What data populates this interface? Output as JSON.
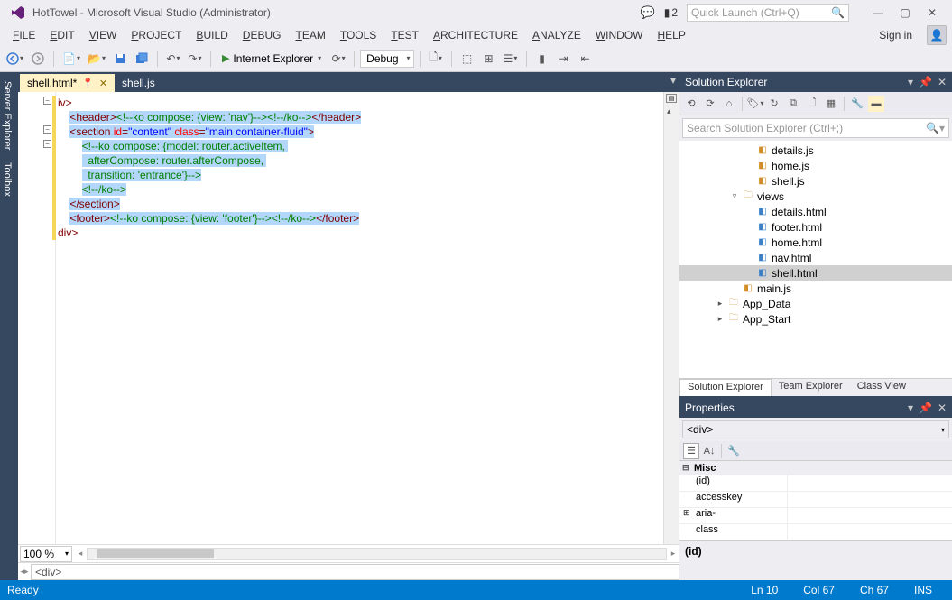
{
  "title": "HotTowel - Microsoft Visual Studio (Administrator)",
  "quick_launch_placeholder": "Quick Launch (Ctrl+Q)",
  "filter_count": "2",
  "menu": [
    "FILE",
    "EDIT",
    "VIEW",
    "PROJECT",
    "BUILD",
    "DEBUG",
    "TEAM",
    "TOOLS",
    "TEST",
    "ARCHITECTURE",
    "ANALYZE",
    "WINDOW",
    "HELP"
  ],
  "signin": "Sign in",
  "start_target": "Internet Explorer",
  "config": "Debug",
  "side_tabs": [
    "Server Explorer",
    "Toolbox"
  ],
  "doc_tabs": [
    {
      "label": "shell.html*",
      "active": true
    },
    {
      "label": "shell.js",
      "active": false
    }
  ],
  "code_lines": [
    {
      "indent": 0,
      "segs": [
        {
          "c": "t-tag",
          "t": "iv"
        },
        {
          "c": "t-tag",
          "t": ">"
        }
      ],
      "sel": false
    },
    {
      "indent": 1,
      "segs": [
        {
          "c": "t-tag",
          "t": "<header>"
        },
        {
          "c": "t-cm",
          "t": "<!--ko compose: {view: 'nav'}-->"
        },
        {
          "c": "t-cm",
          "t": "<!--/ko-->"
        },
        {
          "c": "t-tag",
          "t": "</header>"
        }
      ],
      "sel": true
    },
    {
      "indent": 1,
      "segs": [
        {
          "c": "t-tag",
          "t": "<section "
        },
        {
          "c": "t-attr",
          "t": "id"
        },
        {
          "c": "t-tag",
          "t": "="
        },
        {
          "c": "t-str",
          "t": "\"content\""
        },
        {
          "c": "t-tag",
          "t": " "
        },
        {
          "c": "t-attr",
          "t": "class"
        },
        {
          "c": "t-tag",
          "t": "="
        },
        {
          "c": "t-str",
          "t": "\"main container-fluid\""
        },
        {
          "c": "t-tag",
          "t": ">"
        }
      ],
      "sel": true
    },
    {
      "indent": 2,
      "segs": [
        {
          "c": "t-cm",
          "t": "<!--ko compose: {model: router.activeItem, "
        }
      ],
      "sel": true
    },
    {
      "indent": 2,
      "segs": [
        {
          "c": "t-cm",
          "t": "  afterCompose: router.afterCompose, "
        }
      ],
      "sel": true
    },
    {
      "indent": 2,
      "segs": [
        {
          "c": "t-cm",
          "t": "  transition: 'entrance'}-->"
        }
      ],
      "sel": true
    },
    {
      "indent": 2,
      "segs": [
        {
          "c": "t-cm",
          "t": "<!--/ko-->"
        }
      ],
      "sel": true
    },
    {
      "indent": 1,
      "segs": [
        {
          "c": "t-tag",
          "t": "</section>"
        }
      ],
      "sel": true
    },
    {
      "indent": 1,
      "segs": [
        {
          "c": "t-tag",
          "t": "<footer>"
        },
        {
          "c": "t-cm",
          "t": "<!--ko compose: {view: 'footer'}-->"
        },
        {
          "c": "t-cm",
          "t": "<!--/ko-->"
        },
        {
          "c": "t-tag",
          "t": "</footer>"
        }
      ],
      "sel": true
    },
    {
      "indent": 0,
      "segs": [
        {
          "c": "t-tag",
          "t": "div"
        },
        {
          "c": "t-tag",
          "t": ">"
        }
      ],
      "sel": false
    }
  ],
  "zoom": "100 %",
  "nav_crumb": "<div>",
  "solution_explorer": {
    "title": "Solution Explorer",
    "search_placeholder": "Search Solution Explorer (Ctrl+;)",
    "items": [
      {
        "level": "l1",
        "icon": "js",
        "label": "details.js"
      },
      {
        "level": "l1",
        "icon": "js",
        "label": "home.js"
      },
      {
        "level": "l1",
        "icon": "js",
        "label": "shell.js"
      },
      {
        "level": "l2",
        "icon": "folder",
        "label": "views",
        "expanded": true,
        "twisty": "▿"
      },
      {
        "level": "l1",
        "icon": "html",
        "label": "details.html"
      },
      {
        "level": "l1",
        "icon": "html",
        "label": "footer.html"
      },
      {
        "level": "l1",
        "icon": "html",
        "label": "home.html"
      },
      {
        "level": "l1",
        "icon": "html",
        "label": "nav.html"
      },
      {
        "level": "l1",
        "icon": "html",
        "label": "shell.html",
        "selected": true
      },
      {
        "level": "l2",
        "icon": "js",
        "label": "main.js"
      },
      {
        "level": "l3",
        "icon": "folder",
        "label": "App_Data",
        "twisty": "▸"
      },
      {
        "level": "l3",
        "icon": "folder",
        "label": "App_Start",
        "twisty": "▸"
      }
    ],
    "tabs": [
      "Solution Explorer",
      "Team Explorer",
      "Class View"
    ]
  },
  "properties": {
    "title": "Properties",
    "element": "<div>",
    "category": "Misc",
    "rows": [
      {
        "name": "(id)",
        "val": ""
      },
      {
        "name": "accesskey",
        "val": ""
      },
      {
        "name": "aria-",
        "val": "",
        "expander": "⊞"
      },
      {
        "name": "class",
        "val": ""
      }
    ],
    "desc_title": "(id)",
    "desc_body": ""
  },
  "status": {
    "ready": "Ready",
    "ln": "Ln 10",
    "col": "Col 67",
    "ch": "Ch 67",
    "ins": "INS"
  }
}
